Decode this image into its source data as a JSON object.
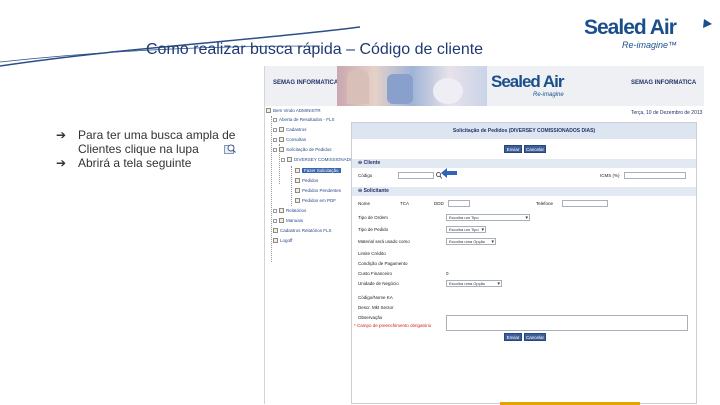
{
  "slide": {
    "title": "Como realizar busca rápida – Código de cliente",
    "brand": "Sealed Air",
    "brand_tagline": "Re-imagine™",
    "bullets": [
      "Para ter uma busca ampla de Clientes clique na lupa",
      "Abrirá a tela seguinte"
    ],
    "bullet_marker": "➔",
    "colors": {
      "title": "#1f3a73",
      "brand": "#1b4f8c",
      "accent_bar": "#e3a400"
    }
  },
  "app": {
    "header_left": "SEMAG INFORMATICA",
    "header_right": "SEMAG INFORMATICA",
    "brand": "Sealed Air",
    "brand_tagline": "Re-imagine",
    "user_line": "Terça, 10 de Dezembro de 2013",
    "tree": [
      "Bem Vindo ADMINISTR",
      "Aberta de Resultados - FLS",
      "Cadastros",
      "Consultas",
      "Solicitação de Pedidos",
      "DIVERSEY COMISSIONADOS - DIAS",
      "Fazer Solicitação",
      "Pedidos",
      "Pedidos Pendentes",
      "Pedidos em PDF",
      "Relatórios",
      "Manuais",
      "Cadastros Relatórios FLS",
      "Logoff"
    ],
    "form": {
      "title": "Solicitação de Pedidos (DIVERSEY COMISSIONADOS DIAS)",
      "btn_enviar": "Enviar",
      "btn_cancelar": "Cancelar",
      "section_cliente": "Cliente",
      "section_solicitante": "Solicitante",
      "codigo_label": "Código",
      "icms_label": "ICMS (%)",
      "nome_label": "Nome",
      "tca_label": "TCA",
      "ddd_label": "DDD",
      "telefone_label": "Telefone",
      "fields": [
        "Tipo de Ordem",
        "Tipo de Pedido",
        "Material será usado como",
        "Limite Crédito",
        "Condição de Pagamento",
        "Custo Financeiro",
        "Unidade de Negócio",
        "Código/Nome KA",
        "Descr. Mkt Sector",
        "Observação"
      ],
      "select_tipo_ordem": "Escolha um Tipo",
      "select_tipo_pedido": "Escolha um Tipo",
      "select_material": "Escolha uma Opção",
      "select_unidade": "Escolha uma Opção",
      "custo_value": "0",
      "required_note": "* Campo de preenchimento obrigatório"
    }
  }
}
